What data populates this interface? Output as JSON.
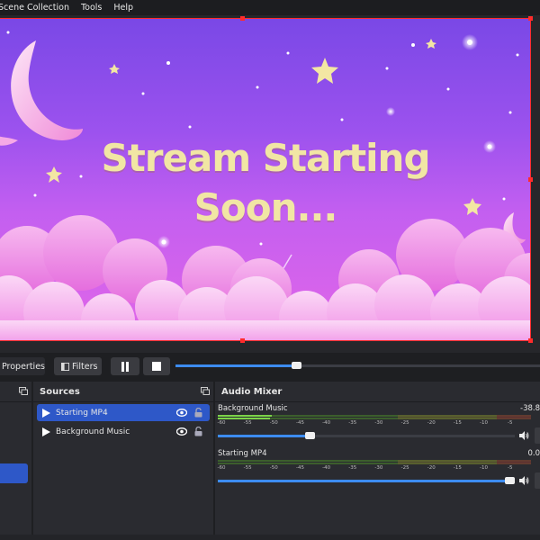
{
  "menu": {
    "items": [
      "Scene Collection",
      "Tools",
      "Help"
    ]
  },
  "preview": {
    "headline_line1": "Stream Starting",
    "headline_line2": "Soon..."
  },
  "controls": {
    "properties_label": "Properties",
    "filters_label": "Filters",
    "seek_progress": 0.33
  },
  "sources": {
    "title": "Sources",
    "items": [
      {
        "label": "Starting MP4",
        "selected": true,
        "visible": true,
        "locked": false
      },
      {
        "label": "Background Music",
        "selected": false,
        "visible": true,
        "locked": false
      }
    ]
  },
  "audio_mixer": {
    "title": "Audio Mixer",
    "channels": [
      {
        "name": "Background Music",
        "level_db": "-38.8",
        "volume": 0.31
      },
      {
        "name": "Starting MP4",
        "level_db": "0.0",
        "volume": 0.99
      }
    ],
    "meter_ticks": [
      "-60",
      "-55",
      "-50",
      "-45",
      "-40",
      "-35",
      "-30",
      "-25",
      "-20",
      "-15",
      "-10",
      "-5"
    ]
  },
  "colors": {
    "accent": "#3d8cf0",
    "selection": "#2e58c8",
    "bounding_box": "#ff2b2b",
    "headline": "#f1e6a4"
  },
  "icons": [
    "play-icon",
    "pause-icon",
    "stop-icon",
    "eye-icon",
    "lock-icon",
    "gear-icon",
    "filter-icon",
    "speaker-icon",
    "float-dock-icon"
  ]
}
